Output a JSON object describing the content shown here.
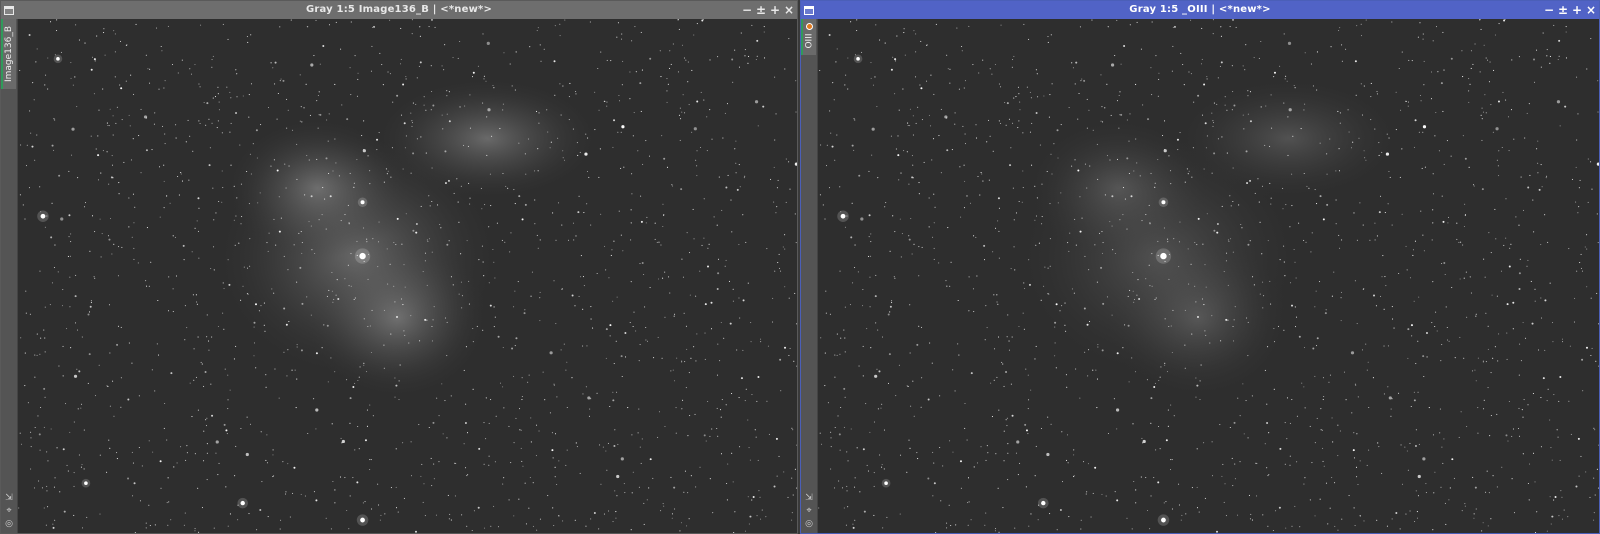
{
  "windows": [
    {
      "title": "Gray 1:5 Image136_B | <*new*>",
      "tab_label": "Image136_B",
      "active": false,
      "nebula_strength": 1.0
    },
    {
      "title": "Gray 1:5 _OIII | <*new*>",
      "tab_label": "OIII",
      "active": true,
      "nebula_strength": 0.6
    }
  ],
  "titlebar_buttons": {
    "minimize": "−",
    "shade": "±",
    "maximize": "+",
    "close": "×"
  },
  "side_icons": [
    "resize-icon",
    "pin-icon",
    "settings-icon"
  ],
  "colors": {
    "active_titlebar": "#5163c6",
    "inactive_titlebar": "#6e6e6e",
    "image_background": "#2c2c2c",
    "tab_accent": "#2f9a5a",
    "marker": "#e07a1f"
  }
}
